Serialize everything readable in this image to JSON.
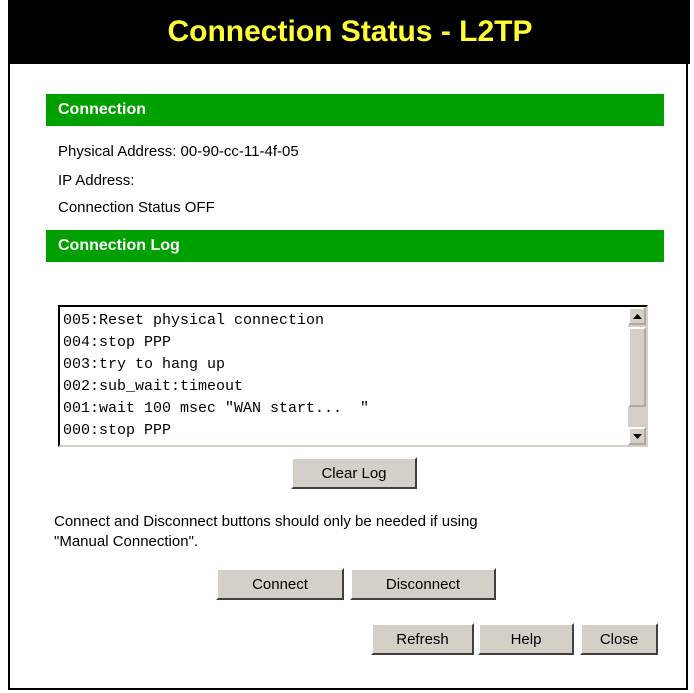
{
  "page": {
    "title": "Connection Status - L2TP",
    "title_color": "#ffff33",
    "header_bg": "#000000",
    "section_color": "#00a000"
  },
  "connection": {
    "heading": "Connection",
    "physical_address": "Physical Address: 00-90-cc-11-4f-05",
    "ip_address": "IP Address:",
    "status": "Connection Status OFF"
  },
  "log": {
    "heading": "Connection Log",
    "lines": [
      "005:Reset physical connection",
      "004:stop PPP",
      "003:try to hang up",
      "002:sub_wait:timeout",
      "001:wait 100 msec \"WAN start...  \"",
      "000:stop PPP"
    ],
    "clear_label": "Clear Log"
  },
  "note": {
    "line1": "Connect and Disconnect buttons should only be needed if using",
    "line2": "\"Manual Connection\"."
  },
  "buttons": {
    "connect": "Connect",
    "disconnect": "Disconnect",
    "refresh": "Refresh",
    "help": "Help",
    "close": "Close"
  },
  "icons": {
    "scroll_up": "arrow-up-icon",
    "scroll_down": "arrow-down-icon"
  }
}
